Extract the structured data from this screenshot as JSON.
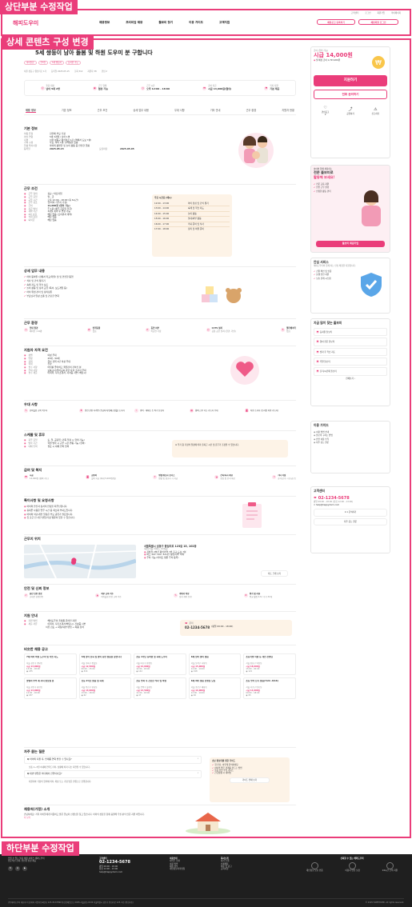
{
  "labels": {
    "top": "상단부분 수정작업",
    "detail": "상세 콘텐츠 구성 변경",
    "bottom": "하단부분 수정작업"
  },
  "header": {
    "logo": "해피도우미",
    "toplinks": [
      "고객센터",
      "로그인",
      "회원가입",
      "마이페이지"
    ],
    "nav": [
      "채용정보",
      "프리미엄 채용",
      "돌보미 찾기",
      "이용 가이드",
      "고객지원"
    ],
    "btn_post": "채용공고 등록하기",
    "btn_login": "채용회원 로그인"
  },
  "job": {
    "title": "5세 쌍둥이 남아 돌봄 및 하원 도우미 분 구합니다",
    "tags": [
      "아이돌봄",
      "주5일",
      "5세 쌍둥이",
      "등하원 가능"
    ],
    "meta": [
      "서울 성동구 왕십리로 1가",
      "등록일 2025.05.15",
      "조회 312",
      "지원자 38",
      "관심 2"
    ],
    "summary": [
      {
        "k": "돌봄 대상",
        "v": "남아 5세 2명"
      },
      {
        "k": "근무 형태",
        "v": "협상 가능"
      },
      {
        "k": "근무 시간",
        "v": "오후 12:00 - 18:00"
      },
      {
        "k": "급여 지급",
        "v": "시급 14,000원(협의)"
      },
      {
        "k": "복지 지원",
        "v": "기본 제공"
      }
    ],
    "tabs": [
      "채용 정보",
      "기본 정보",
      "근무 조건",
      "상세 업무 내용",
      "우대 사항",
      "기타 안내",
      "근무 환경",
      "지원자 현황"
    ]
  },
  "basic": {
    "title": "기본 정보",
    "rows": [
      [
        "아동 유형",
        "집안에 부모 가정"
      ],
      [
        "아이 연령",
        "5세 3개월 / 남아 1명"
      ],
      [
        "지역",
        "서울 성동구 왕십리로 1가 (역에서 도보 7분)"
      ],
      [
        "가족 구성",
        "부모, 아이 1명, 반려동물 없음"
      ],
      [
        "돌봄 특이사항",
        "아이의 활발한 및 놀이 활동 중 안전한 돌봄"
      ],
      [
        "등록일",
        "2025.05.15"
      ]
    ],
    "deadline_k": "모집마감",
    "deadline": "2025.05.05"
  },
  "cond": {
    "title": "근무 조건",
    "rows": [
      [
        "근무 형태",
        "정규 / 파트타임"
      ],
      [
        "근무 요일",
        "월 - 금"
      ],
      [
        "근무 시간",
        "오후 12:00 - 18:00 (총 6시간)"
      ],
      [
        "근무 장소",
        "집(아이 거주지 가정)"
      ],
      [
        "급여",
        "14,000원 (협의 가능)"
      ],
      [
        "지급 방식",
        "주 1회 (매주 금요일 입금)"
      ],
      [
        "계약 기간",
        "3개월 계약 후 연장 가능"
      ],
      [
        "4대 보험",
        "해당 없음 (프리랜서 계약)"
      ],
      [
        "식대 보험",
        "해당 없음"
      ],
      [
        "퇴직금",
        "해당 없음"
      ]
    ],
    "sched_title": "주요 시간표 (예시)",
    "sched": [
      [
        "12:00 - 13:00",
        "아이 점심 및 간식 챙기"
      ],
      [
        "13:00 - 14:00",
        "숙제 및 학습 지도"
      ],
      [
        "14:00 - 15:00",
        "놀이 활동"
      ],
      [
        "15:00 - 16:00",
        "실내/외부 활동"
      ],
      [
        "16:00 - 17:00",
        "저녁 준비 및 식사"
      ],
      [
        "17:00 - 18:00",
        "정리 및 하원 준비"
      ]
    ]
  },
  "duty": {
    "title": "상세 업무 내용",
    "items": [
      "아이 등하원 (집에서 학교/학원) 및 및 안전한 동행",
      "식사 및 간식 챙기기",
      "숙제 지도 및 학습 보조",
      "놀이 활동 및 정서 교류 (독서, 보드게임 등)",
      "아이 위생 관리 및 정리정돈",
      "부모님과 일상 소통 및 간단한 연락"
    ]
  },
  "env": {
    "title": "근무 환경",
    "items": [
      [
        "업내 환경",
        "에어컨 / 24평"
      ],
      [
        "반려동물",
        "없음"
      ],
      [
        "흡연 여부",
        "비흡연 가정"
      ],
      [
        "CCTV 설치",
        "공용 공간 설치 (현관, 거실)"
      ],
      [
        "엘리베이터",
        "있음"
      ]
    ]
  },
  "req": {
    "title": "지원자 자격 요건",
    "rows": [
      [
        "성별",
        "여성 우대"
      ],
      [
        "연령",
        "25세 - 50세"
      ],
      [
        "경력",
        "유사 경력 1년 이상 우대"
      ],
      [
        "학력",
        "무관"
      ],
      [
        "필수 사항",
        "아이를 좋아하고 책임감이 강하신 분"
      ],
      [
        "우대 사항",
        "보육교사/유아교육 관련 자격 소지자 우대"
      ],
      [
        "필수 제출",
        "이력서, 자기소개서, 자격증 사본 (해당시)"
      ]
    ]
  },
  "pref": {
    "title": "우대 사항",
    "items": [
      "유아돌봄 교육 이수자",
      "안전 관련 자격증 (응급처치/심폐소생술) 소지자",
      "영어 · 예체능 등 특기 보유자",
      "협의 근무 가능 가능자 우대",
      "차량 소지자 (등하원 차량 가능자)"
    ]
  },
  "proc": {
    "title": "스케줄 및 휴무",
    "rows": [
      [
        "휴무 요일",
        "토, 일, 공휴일 (가족 일정 시 협의 가능)"
      ],
      [
        "방학 기간",
        "학원 방학 시 근무 시간 변동 가능 (협의)"
      ],
      [
        "대체 인력",
        "필요 시 대체 인력 협의"
      ]
    ],
    "note": "※ 학기 중 가정의 일정에 따라 출퇴근 시간 및 휴무가 조정될 수 있습니다."
  },
  "ben": {
    "title": "급여 및 복지",
    "items": [
      [
        "시급",
        "14,000원 (협의 가능)"
      ],
      [
        "교통비",
        "실비 지급 (최대 5,000원/일)"
      ],
      [
        "명절/경조사 보너스",
        "명절 및 경조사 시 지급"
      ],
      [
        "간식/식사 제공",
        "점심 및 간식 제공"
      ],
      [
        "기타 지원",
        "휴가(근속 시 유급) 등"
      ]
    ]
  },
  "notice": {
    "title": "특이사항 및 요청사항",
    "items": [
      "아이의 안전과 정서적 안정을 최우선합니다.",
      "휴대폰 사용은 업무 시간 중 최소화 부탁드립니다.",
      "아이의 식단/개인 일정은 부모 공유가 필요합니다.",
      "첫 출근 전 사전 면접/가정 방문이 있을 수 있습니다."
    ]
  },
  "loc": {
    "title": "근무지 위치",
    "addr": "서울특별시 성동구 왕십리로 123길 15, 102동",
    "addr2": "(왕십리동 아파트 102동)",
    "lines": [
      "지하철 2호선 왕십리역 7번 출구 도보 7분",
      "버스 201, 222, 421번 '왕십리역' 하차",
      "주차 가능 (아파트 방문 주차 등록)"
    ],
    "btn": "지도 크게 보기"
  },
  "safety": {
    "title": "안전 및 신뢰 정보",
    "items": [
      [
        "본인 인증 완료",
        "휴대폰 본인인증"
      ],
      [
        "직무 교육 이수",
        "아이돌봄 안전 교육 이수"
      ],
      [
        "계약서 작성",
        "정식 계약 진행"
      ],
      [
        "평가 및 리뷰",
        "평균 별점 4.8 / 후기 32개"
      ]
    ]
  },
  "apply": {
    "title": "지원 안내",
    "rows": [
      [
        "지원 방법",
        "해피도우미 플랫폼 온라인 지원"
      ],
      [
        "제출 서류",
        "이력서, 자기소개서(해당시), 신분증 사본"
      ],
      [
        "",
        "서류 검토 → 화상/대면 면접 → 최종 합격"
      ]
    ],
    "phone_k": "문의",
    "phone": "02-1234-5678",
    "phone_hours": "(평일 09:00 - 18:00)"
  },
  "similar": {
    "title": "비슷한 채용 공고",
    "cards": [
      {
        "t": "7세 여아 하원 도우미 및 학습 지도",
        "a": "서울 성동구 행당동",
        "p": "시급 13,000원",
        "h": "13:00 - 18:00",
        "v": "235"
      },
      {
        "t": "3세 남아 보육 및 놀이 동반 돌봄을 찾습니다",
        "a": "서울 송파구 잠실동",
        "p": "시급 12,500원",
        "h": "09:00 - 15:00",
        "v": "316"
      },
      {
        "t": "초등 1학년 등하원 및 숙제 도우미",
        "a": "서울 마포구 합정동",
        "p": "시급 14,000원",
        "h": "12:00 - 18:00",
        "v": "142"
      },
      {
        "t": "6세 남아 놀이 돌봄",
        "a": "서울 동작구 사당동",
        "p": "시급 15,000원",
        "h": "14:00 - 19:00",
        "v": "198"
      },
      {
        "t": "초등학생 미술 등 개인 선생님",
        "a": "서울 강남구 역삼동",
        "p": "시급 18,000원",
        "h": "15:00 - 20:00",
        "v": "121"
      },
      {
        "t": "맞벌이 부부 세 자녀 돌보실 분",
        "a": "서울 광진구 화양동",
        "p": "시급 13,000원",
        "h": "12:00 - 18:00",
        "v": "187"
      },
      {
        "t": "초등 2학년 돌봄 및 숙제",
        "a": "서울 용산구 한남동",
        "p": "시급 13,000원",
        "h": "13:00 - 18:00",
        "v": "62"
      },
      {
        "t": "초등 방과 후 간단한 식사 및 하원",
        "a": "서울 은평구 불광동",
        "p": "시급 13,500원",
        "h": "11:00 - 18:00",
        "v": "47"
      },
      {
        "t": "6세 여아 돌봄 산생님 모집",
        "a": "서울 종로구 혜화동",
        "p": "시급 16,000원",
        "h": "12:00 - 19:00",
        "v": "46"
      },
      {
        "t": "초등 방학 단기 돌봄(7/22~8/16)",
        "a": "서울 서초구 반포동",
        "p": "시급 14,000원",
        "h": "09:00 - 18:00",
        "v": "95"
      }
    ]
  },
  "faq": {
    "title": "자주 묻는 질문",
    "items": [
      {
        "q": "아이의 지원 후, 언제쯤 연락 받을 수 있나요?",
        "a": "보통 1~3일 이내에 연락드리며, 상황에 따라 다소 지연될 수 있습니다."
      },
      {
        "q": "대면 면접은 어디에서 진행되나요?",
        "a": "지원자와 가정의 협의에 따라, 화상 또는 가정 방문 면접으로 진행됩니다."
      }
    ],
    "guide_title": "초보 돌보미를 위한 가이드",
    "guide": [
      "첫 만남, 이렇게 준비하세요",
      "아이의 좋은 관계를 만드는 방법",
      "돌봄 안전 수칙 가이드",
      "긴급상황 시 대처법"
    ],
    "guide_btn": "가이드 전체 보기"
  },
  "intro": {
    "title": "채용처(가정) 소개",
    "text": "안녕하세요! 저희 아이들에게 따뜻하고 밝은 돌보미 선생님을 찾고 있습니다. 아이의 성장을 함께 응원해 주실 분의 많은 지원 바랍니다.",
    "more": "더 보기"
  },
  "side": {
    "wage_k": "급여 (협의 가능)",
    "wage": "시급 14,000원",
    "wage_sub": "월 예상 급여 1,723,200원",
    "apply_btn": "지원하기",
    "ask_btn": "전화 문의하기",
    "icons": [
      "관심공고",
      "공유하기",
      "신고하기"
    ],
    "icon_vals": [
      "2",
      "",
      " "
    ],
    "promo_t1": "아이와 함께 성장하는",
    "promo_t2": "전문 돌보미로",
    "promo_t3": "활동해 보세요!",
    "promo_items": [
      "전문 교육 지원",
      "안전 근무 환경",
      "안정한 활동 관리"
    ],
    "promo_btn": "돌보미 회원가입",
    "safe_t": "안심 서비스",
    "safe_d": "해피도우미와 함께 하는 안심 매칭을 지원합니다.",
    "safe_items": [
      "신원 확인 및 인증",
      "분쟁 안전 지원",
      "보호 관계 시스템"
    ],
    "pop_t": "지금 많이 찾는 돌보미",
    "pop": [
      "등하원 돌보미",
      "영아 전문 돌보미",
      "방과 후 학습 지도",
      "주말 돌보미",
      "단기/시간제 돌보미"
    ],
    "pop_more": "전체보기",
    "guide_t": "이용 가이드",
    "guide": [
      "이용 방법 안내",
      "돌보미 구하는 방법",
      "안전 이용 수칙",
      "자주 묻는 질문"
    ],
    "cs_t": "고객센터",
    "cs_phone": "02-1234-5678",
    "cs_hours": "평일 09:00 - 18:00 (점심 12:00 - 13:00)",
    "cs_mail": "help@happydomi.com",
    "cs_btn1": "1:1 문의하기",
    "cs_btn2": "자주 묻는 질문"
  },
  "footer": {
    "desc": "믿을 수 있는 돌봄 매칭 서비스 해피도우미",
    "desc2": "전문적인 신뢰, 안전한 환경 제공",
    "cs_t": "고객센터",
    "phone": "02-1234-5678",
    "hours": "평일 09:00 - 18:00",
    "hours2": "점심 12:00 - 13:00",
    "mail": "help@happydomi.com",
    "col1_t": "이용안내",
    "col1": [
      "서비스 소개",
      "이용 방법",
      "채용 정보",
      "개인정보처리방침"
    ],
    "col2_t": "회사소개",
    "col2": [
      "회사 소개",
      "인재채용",
      "제휴 및 광고",
      "공지사항"
    ],
    "trust_t": "신뢰할 수 있는 해피도우미",
    "trust": [
      "개인정보 보호 인증",
      "이용자 안전 보장",
      "24시간 고객 지원"
    ],
    "bottom": "(주)해피도우미  대표자:이 김해피  사업자등록번호 123-45-67890  통신판매업신고 2025-서울성동-0134  서울특별시 성동구 왕십리로 123, 4층 (왕십리동)",
    "copy": "© 2025 HAPPYDOMI. All rights reserved."
  },
  "colors": {
    "accent": "#ea3d7a",
    "orange": "#f08a1a",
    "footer_bg": "#1f1f1f"
  }
}
